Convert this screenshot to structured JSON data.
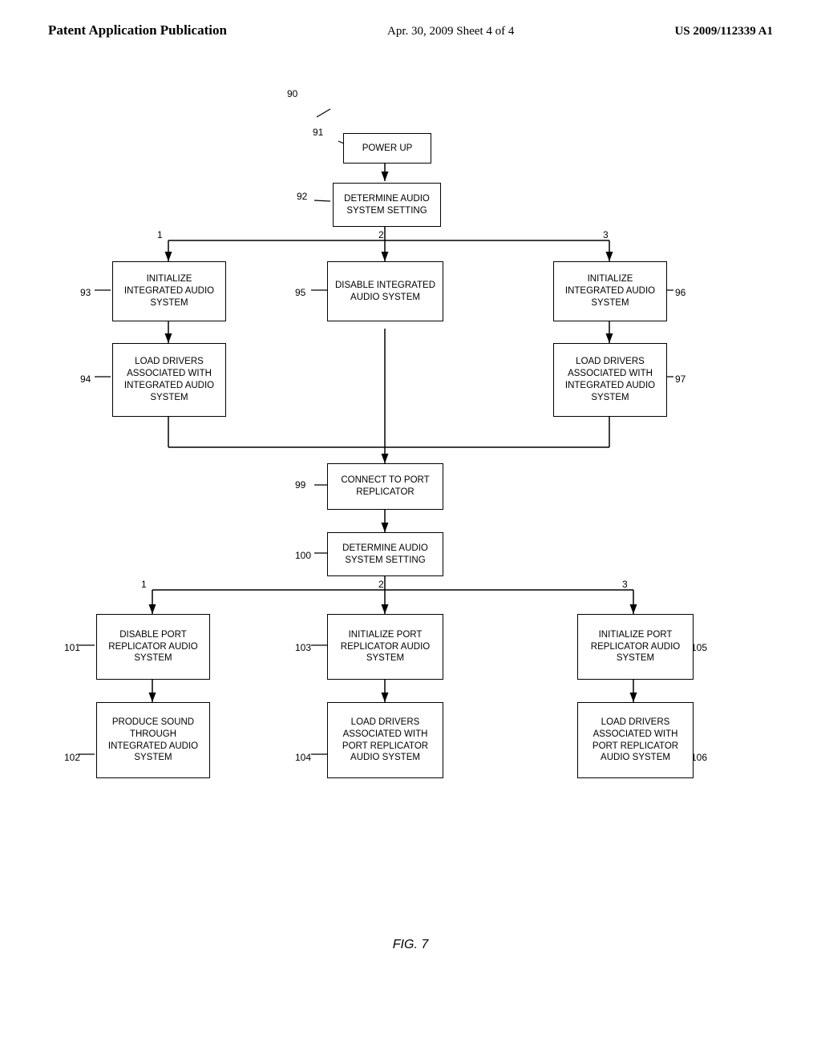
{
  "header": {
    "left": "Patent Application Publication",
    "center": "Apr. 30, 2009   Sheet 4 of 4",
    "right": "US 2009/112339 A1"
  },
  "diagram": {
    "title": "90",
    "fig_label": "FIG. 7",
    "nodes": {
      "n90": {
        "label": "90",
        "type": "ref"
      },
      "n91_ref": {
        "label": "91",
        "type": "ref"
      },
      "n91": {
        "label": "POWER UP"
      },
      "n92_ref": {
        "label": "92",
        "type": "ref"
      },
      "n92": {
        "label": "DETERMINE AUDIO\nSYSTEM SETTING"
      },
      "n93_ref": {
        "label": "93",
        "type": "ref"
      },
      "n93": {
        "label": "INITIALIZE\nINTEGRATED\nAUDIO SYSTEM"
      },
      "n94_ref": {
        "label": "94",
        "type": "ref"
      },
      "n94": {
        "label": "LOAD DRIVERS\nASSOCIATED WITH\nINTEGRATED\nAUDIO SYSTEM"
      },
      "n95_ref": {
        "label": "95",
        "type": "ref"
      },
      "n95": {
        "label": "DISABLE\nINTEGRATED\nAUDIO SYSTEM"
      },
      "n96_ref": {
        "label": "96",
        "type": "ref"
      },
      "n96": {
        "label": "INITIALIZE\nINTEGRATED\nAUDIO SYSTEM"
      },
      "n97_ref": {
        "label": "97",
        "type": "ref"
      },
      "n97": {
        "label": "LOAD DRIVERS\nASSOCIATED WITH\nINTEGRATED\nAUDIO SYSTEM"
      },
      "n99_ref": {
        "label": "99",
        "type": "ref"
      },
      "n99": {
        "label": "CONNECT TO PORT\nREPLICATOR"
      },
      "n100_ref": {
        "label": "100",
        "type": "ref"
      },
      "n100": {
        "label": "DETERMINE AUDIO\nSYSTEM SETTING"
      },
      "n101_ref": {
        "label": "101",
        "type": "ref"
      },
      "n101": {
        "label": "DISABLE PORT\nREPLICATOR\nAUDIO SYSTEM"
      },
      "n102_ref": {
        "label": "102",
        "type": "ref"
      },
      "n102": {
        "label": "PRODUCE SOUND\nTHROUGH\nINTEGRATED\nAUDIO SYSTEM"
      },
      "n103_ref": {
        "label": "103",
        "type": "ref"
      },
      "n103": {
        "label": "INITIALIZE PORT\nREPLICATOR\nAUDIO SYSTEM"
      },
      "n104_ref": {
        "label": "104",
        "type": "ref"
      },
      "n104": {
        "label": "LOAD DRIVERS\nASSOCIATED WITH\nPORT REPLICATOR\nAUDIO SYSTEM"
      },
      "n105_ref": {
        "label": "105",
        "type": "ref"
      },
      "n105": {
        "label": "INITIALIZE PORT\nREPLICATOR\nAUDIO SYSTEM"
      },
      "n106_ref": {
        "label": "106",
        "type": "ref"
      },
      "n106": {
        "label": "LOAD DRIVERS\nASSOCIATED WITH\nPORT REPLICATOR\nAUDIO SYSTEM"
      }
    },
    "branch_labels": {
      "b1a": "1",
      "b2a": "2",
      "b3a": "3",
      "b1b": "1",
      "b2b": "2",
      "b3b": "3"
    }
  }
}
